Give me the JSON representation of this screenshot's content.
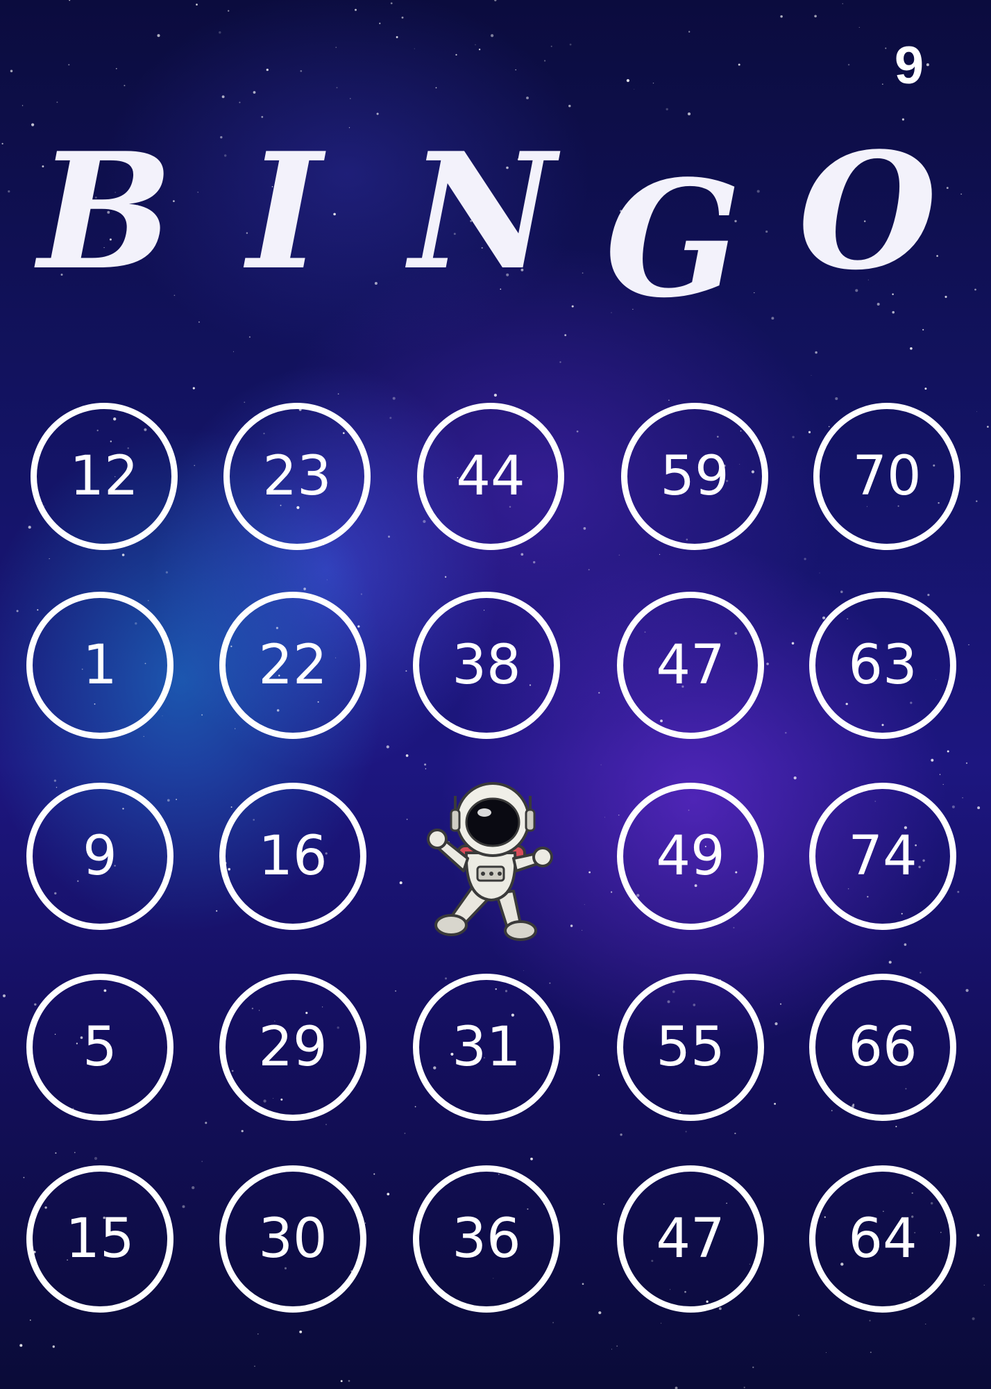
{
  "card": {
    "number": "9",
    "title_letters": [
      "B",
      "I",
      "N",
      "G",
      "O"
    ],
    "rows": [
      [
        "12",
        "23",
        "44",
        "59",
        "70"
      ],
      [
        "1",
        "22",
        "38",
        "47",
        "63"
      ],
      [
        "9",
        "16",
        "",
        "49",
        "74"
      ],
      [
        "5",
        "29",
        "31",
        "55",
        "66"
      ],
      [
        "15",
        "30",
        "36",
        "47",
        "64"
      ]
    ],
    "free_space_icon": "astronaut-icon"
  },
  "colors": {
    "text": "#ffffff",
    "background": "#141468",
    "accent_blue": "#1e8cdc",
    "accent_purple": "#7832e6"
  }
}
